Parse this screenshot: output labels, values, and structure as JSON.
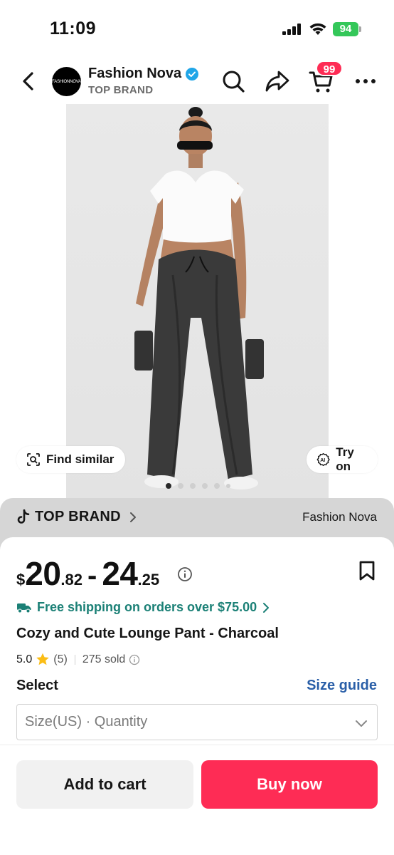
{
  "status_bar": {
    "time": "11:09",
    "battery": "94"
  },
  "header": {
    "shop_name": "Fashion Nova",
    "shop_subtitle": "TOP BRAND",
    "logo_text": "FASHIONNOVA",
    "cart_count": "99",
    "icons": [
      "back-arrow-icon",
      "search-icon",
      "share-icon",
      "cart-icon",
      "more-icon"
    ]
  },
  "gallery": {
    "find_similar": "Find similar",
    "try_on": "Try on",
    "image_count": 6,
    "active_index": 0
  },
  "brand_bar": {
    "label": "TOP BRAND",
    "shop": "Fashion Nova"
  },
  "product": {
    "price": {
      "currency": "$",
      "low_whole": "20",
      "low_cents": ".82",
      "dash": "-",
      "high_whole": "24",
      "high_cents": ".25"
    },
    "shipping": "Free shipping on orders over $75.00",
    "title": "Cozy and Cute Lounge Pant - Charcoal",
    "rating": "5.0",
    "review_count": "(5)",
    "sold": "275 sold"
  },
  "select": {
    "label": "Select",
    "size_guide": "Size guide",
    "placeholder": "Size(US) · Quantity"
  },
  "actions": {
    "add_to_cart": "Add to cart",
    "buy_now": "Buy now"
  },
  "colors": {
    "accent": "#fe2c55",
    "shipping": "#1b8076",
    "link": "#2a5fa8",
    "brand_bar": "#d6d6d6"
  }
}
